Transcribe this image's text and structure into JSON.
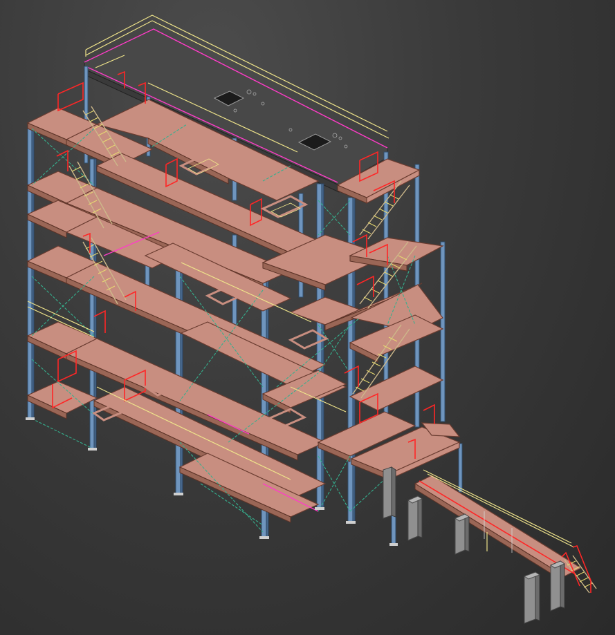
{
  "viewport": {
    "view": "perspective",
    "render_mode": "shaded",
    "background_color": "#2b2b2b"
  },
  "model": {
    "type": "multi-storey steel structure with stairs, handrails, bracing and a sloped conveyor gallery",
    "floor_levels": 6,
    "colors": {
      "beams": "#c88e80",
      "columns": "#6f95be",
      "bracing": "#35b08e",
      "handrails": "#ff2626",
      "stairs": "#e8db70",
      "roof_edge": "#ff3cc8",
      "pedestals": "#909090",
      "roof_slab": "#484848"
    },
    "components": [
      "column-grid",
      "floor-beams",
      "roof-slab",
      "vertical-bracing",
      "stairs",
      "handrails",
      "conveyor-gallery",
      "pedestals"
    ]
  }
}
